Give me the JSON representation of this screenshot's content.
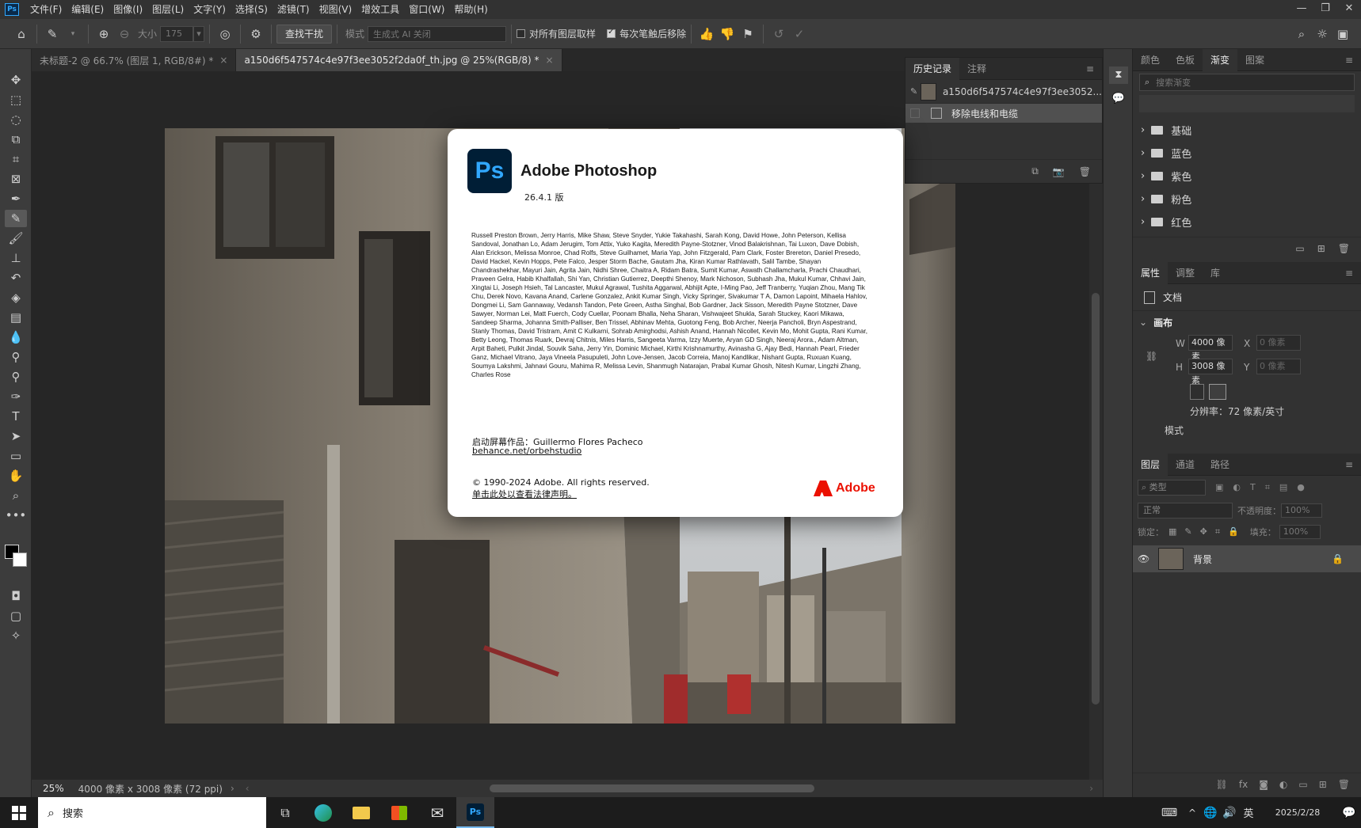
{
  "menubar": {
    "app_icon": "Ps",
    "items": [
      "文件(F)",
      "编辑(E)",
      "图像(I)",
      "图层(L)",
      "文字(Y)",
      "选择(S)",
      "滤镜(T)",
      "视图(V)",
      "增效工具",
      "窗口(W)",
      "帮助(H)"
    ]
  },
  "optionsbar": {
    "size_label": "大小",
    "size_value": "175",
    "find_button": "查找干扰",
    "mode_label": "模式",
    "mode_value": "生成式 AI 关闭",
    "sample_all_label": "对所有图层取样",
    "remove_after_label": "每次笔触后移除"
  },
  "tabs": [
    {
      "label": "未标题-2 @ 66.7% (图层 1, RGB/8#) *",
      "active": false
    },
    {
      "label": "a150d6f547574c4e97f3ee3052f2da0f_th.jpg @ 25%(RGB/8) *",
      "active": true
    }
  ],
  "status": {
    "zoom": "25%",
    "doc_info": "4000 像素 x 3008 像素 (72 ppi)"
  },
  "history": {
    "tabs": [
      "历史记录",
      "注释"
    ],
    "snapshot_label": "a150d6f547574c4e97f3ee3052...",
    "step_label": "移除电线和电缆"
  },
  "about": {
    "logo": "Ps",
    "title": "Adobe Photoshop",
    "version": "26.4.1 版",
    "credits": "Russell Preston Brown, Jerry Harris, Mike Shaw, Steve Snyder, Yukie Takahashi, Sarah Kong, David Howe, John Peterson, Kellisa Sandoval, Jonathan Lo, Adam Jerugim, Tom Attix, Yuko Kagita, Meredith Payne-Stotzner, Vinod Balakrishnan, Tai Luxon, Dave Dobish, Alan Erickson, Melissa Monroe, Chad Rolfs, Steve Guilhamet, Maria Yap, John Fitzgerald, Pam Clark, Foster Brereton, Daniel Presedo, David Hackel, Kevin Hopps, Pete Falco, Jesper Storm Bache, Gautam Jha, Kiran Kumar Rathlavath, Salil Tambe, Shayan Chandrashekhar, Mayuri Jain, Agrita Jain, Nidhi Shree, Chaitra A, Ridam Batra, Sumit Kumar, Aswath Challamcharla, Prachi Chaudhari, Praveen Gelra, Habib Khalfallah, Shi Yan, Christian Gutierrez, Deepthi Shenoy, Mark Nichoson, Subhash Jha, Mukul Kumar, Chhavi Jain, Xingtai Li, Joseph Hsieh, Tal Lancaster, Mukul Agrawal, Tushita Aggarwal, Abhijit Apte, I-Ming Pao, Jeff Tranberry, Yuqian Zhou, Mang Tik Chu, Derek Novo, Kavana Anand, Carlene Gonzalez, Ankit Kumar Singh, Vicky Springer, Sivakumar T A, Damon Lapoint, Mihaela Hahlov, Dongmei Li, Sam Gannaway, Vedansh Tandon, Pete Green, Astha Singhal, Bob Gardner, Jack Sisson, Meredith Payne Stotzner, Dave Sawyer, Norman Lei, Matt Fuerch, Cody Cuellar, Poonam Bhalla, Neha Sharan, Vishwajeet Shukla, Sarah Stuckey, Kaori Mikawa, Sandeep Sharma, Johanna Smith-Palliser, Ben Trissel, Abhinav Mehta, Guotong Feng, Bob Archer, Neerja Pancholi, Bryn Aspestrand, Stanly Thomas, David Tristram, Amit C Kulkarni, Sohrab Amirghodsi, Ashish Anand, Hannah Nicollet, Kevin Mo, Mohit Gupta, Rani Kumar, Betty Leong, Thomas Ruark, Devraj Chitnis, Miles Harris, Sangeeta Varma, Izzy Muerte, Aryan GD Singh, Neeraj Arora., Adam Altman, Arpit Baheti, Pulkit Jindal, Souvik Saha, Jerry Yin, Dominic Michael, Kirthi Krishnamurthy, Avinasha G, Ajay Bedi, Hannah Pearl, Frieder Ganz, Michael Vitrano, Jaya Vineela Pasupuleti, John Love-Jensen, Jacob Correia, Manoj Kandlikar, Nishant Gupta, Ruxuan Kuang, Soumya Lakshmi, Jahnavi Gouru, Mahima R, Melissa Levin, Shanmugh Natarajan, Prabal Kumar Ghosh, Nitesh Kumar, Lingzhi Zhang, Charles Rose",
    "splash_label": "启动屏幕作品：",
    "splash_artist": "Guillermo Flores Pacheco",
    "splash_link": "behance.net/orbehstudio",
    "copyright": "© 1990-2024 Adobe. All rights reserved.",
    "legal_link": "单击此处以查看法律声明。",
    "adobe_brand": "Adobe"
  },
  "gradients_panel": {
    "tabs": [
      "颜色",
      "色板",
      "渐变",
      "图案"
    ],
    "search_placeholder": "搜索渐变",
    "groups": [
      "基础",
      "蓝色",
      "紫色",
      "粉色",
      "红色"
    ]
  },
  "properties_panel": {
    "tabs": [
      "属性",
      "调整",
      "库"
    ],
    "doc_label": "文档",
    "canvas_section": "画布",
    "w_label": "W",
    "w_value": "4000 像素",
    "h_label": "H",
    "h_value": "3008 像素",
    "x_label": "X",
    "x_value": "0 像素",
    "y_label": "Y",
    "y_value": "0 像素",
    "resolution": "分辨率：72 像素/英寸",
    "mode_label": "模式"
  },
  "layers_panel": {
    "tabs": [
      "图层",
      "通道",
      "路径"
    ],
    "filter_placeholder": "类型",
    "blend_mode": "正常",
    "opacity_label": "不透明度：",
    "opacity_value": "100%",
    "lock_label": "锁定：",
    "fill_label": "填充：",
    "fill_value": "100%",
    "layer_name": "背景"
  },
  "taskbar": {
    "search_placeholder": "搜索",
    "ime_label": "英",
    "date": "2025/2/28"
  },
  "colors": {
    "ps_blue": "#31a8ff",
    "adobe_red": "#eb1000"
  }
}
